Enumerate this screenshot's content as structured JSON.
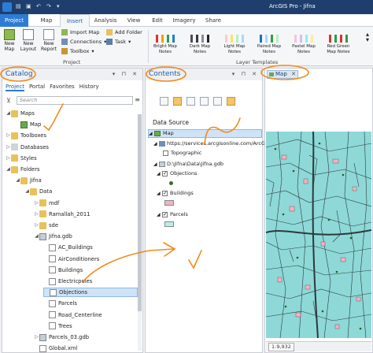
{
  "app": {
    "window_title": "ArcGIS Pro - Jifna"
  },
  "ribbon_tabs": [
    "Project",
    "Map",
    "Insert",
    "Analysis",
    "View",
    "Edit",
    "Imagery",
    "Share"
  ],
  "ribbon": {
    "new_map": "New Map",
    "new_layout": "New Layout",
    "new_report": "New Report",
    "import_map": "Import Map",
    "connections": "Connections",
    "toolbox": "Toolbox",
    "add_folder": "Add Folder",
    "task": "Task",
    "group_project": "Project",
    "group_layer_templates": "Layer Templates",
    "templates": [
      {
        "label": "Bright Map Notes",
        "colors": [
          "#e03131",
          "#f59f00",
          "#2f9e44",
          "#1c7ed6"
        ]
      },
      {
        "label": "Dark Map Notes",
        "colors": [
          "#495057",
          "#343a40",
          "#868e96",
          "#212529"
        ]
      },
      {
        "label": "Light Map Notes",
        "colors": [
          "#ffc9c9",
          "#ffe066",
          "#b2f2bb",
          "#a5d8ff"
        ]
      },
      {
        "label": "Paired Map Notes",
        "colors": [
          "#1971c2",
          "#a5d8ff",
          "#2f9e44",
          "#b2f2bb"
        ]
      },
      {
        "label": "Pastel Map Notes",
        "colors": [
          "#fcc2d7",
          "#d0bfff",
          "#99e9f2",
          "#ffec99"
        ]
      },
      {
        "label": "Red Green Map Notes",
        "colors": [
          "#e03131",
          "#2f9e44",
          "#e03131",
          "#2f9e44"
        ]
      }
    ]
  },
  "catalog": {
    "title": "Catalog",
    "tabs": [
      "Project",
      "Portal",
      "Favorites",
      "History"
    ],
    "search_placeholder": "Search",
    "items": [
      {
        "label": "Maps",
        "arrow": "◢",
        "icon": "folder"
      },
      {
        "label": "Map",
        "arrow": "",
        "icon": "map"
      },
      {
        "label": "Toolboxes",
        "arrow": "▷",
        "icon": "folder"
      },
      {
        "label": "Databases",
        "arrow": "▷",
        "icon": "db"
      },
      {
        "label": "Styles",
        "arrow": "▷",
        "icon": "folder"
      },
      {
        "label": "Folders",
        "arrow": "◢",
        "icon": "folder"
      },
      {
        "label": "Jifna",
        "arrow": "◢",
        "icon": "folder"
      },
      {
        "label": "Data",
        "arrow": "◢",
        "icon": "folder"
      },
      {
        "label": "mdf",
        "arrow": "▷",
        "icon": "folder"
      },
      {
        "label": "Ramallah_2011",
        "arrow": "▷",
        "icon": "folder"
      },
      {
        "label": "sde",
        "arrow": "▷",
        "icon": "folder"
      },
      {
        "label": "Jifna.gdb",
        "arrow": "◢",
        "icon": "gdb"
      },
      {
        "label": "AC_Buildings",
        "arrow": "",
        "icon": "fc"
      },
      {
        "label": "AirConditioners",
        "arrow": "",
        "icon": "fc"
      },
      {
        "label": "Buildings",
        "arrow": "",
        "icon": "fc"
      },
      {
        "label": "Electricpoles",
        "arrow": "",
        "icon": "fc"
      },
      {
        "label": "Objections",
        "arrow": "",
        "icon": "fc"
      },
      {
        "label": "Parcels",
        "arrow": "",
        "icon": "fc"
      },
      {
        "label": "Road_Centerline",
        "arrow": "",
        "icon": "fc"
      },
      {
        "label": "Trees",
        "arrow": "",
        "icon": "fc"
      },
      {
        "label": "Parcels_03.gdb",
        "arrow": "▷",
        "icon": "gdb"
      },
      {
        "label": "Global.xml",
        "arrow": "",
        "icon": "fc"
      }
    ]
  },
  "contents": {
    "title": "Contents",
    "section": "Data Source",
    "map": "Map",
    "server": "https://services.arcgisonline.com/ArcGIS",
    "topographic": "Topographic",
    "gdb_path": "D:\\Jifna\\Data\\Jifna.gdb",
    "layers": [
      "Objections",
      "Buildings",
      "Parcels"
    ]
  },
  "map": {
    "tab_label": "Map",
    "scale": "1:9,932"
  }
}
